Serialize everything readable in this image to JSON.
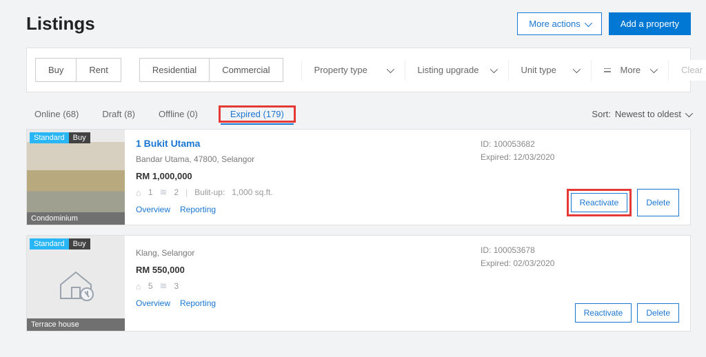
{
  "page": {
    "title": "Listings"
  },
  "top_actions": {
    "more": "More actions",
    "add": "Add a property"
  },
  "filters": {
    "seg1": [
      "Buy",
      "Rent"
    ],
    "seg2": [
      "Residential",
      "Commercial"
    ],
    "drops": {
      "property_type": "Property type",
      "listing_upgrade": "Listing upgrade",
      "unit_type": "Unit type",
      "more": "More",
      "clear": "Clear"
    }
  },
  "tabs": {
    "online": "Online (68)",
    "draft": "Draft (8)",
    "offline": "Offline (0)",
    "expired": "Expired (179)"
  },
  "sort": {
    "label": "Sort:",
    "value": "Newest to oldest"
  },
  "listings": [
    {
      "badges": {
        "tier": "Standard",
        "type": "Buy"
      },
      "category": "Condominium",
      "title": "1 Bukit Utama",
      "subtitle": "Bandar Utama, 47800, Selangor",
      "price": "RM 1,000,000",
      "beds": "1",
      "baths": "2",
      "builtup_label": "Bulit-up:",
      "builtup_value": "1,000 sq.ft.",
      "links": {
        "overview": "Overview",
        "reporting": "Reporting"
      },
      "id_label": "ID:",
      "id": "100053682",
      "exp_label": "Expired:",
      "exp": "12/03/2020",
      "actions": {
        "reactivate": "Reactivate",
        "delete": "Delete"
      }
    },
    {
      "badges": {
        "tier": "Standard",
        "type": "Buy"
      },
      "category": "Terrace house",
      "title": "",
      "subtitle": "Klang, Selangor",
      "price": "RM 550,000",
      "beds": "5",
      "baths": "3",
      "links": {
        "overview": "Overview",
        "reporting": "Reporting"
      },
      "id_label": "ID:",
      "id": "100053678",
      "exp_label": "Expired:",
      "exp": "02/03/2020",
      "actions": {
        "reactivate": "Reactivate",
        "delete": "Delete"
      }
    }
  ]
}
